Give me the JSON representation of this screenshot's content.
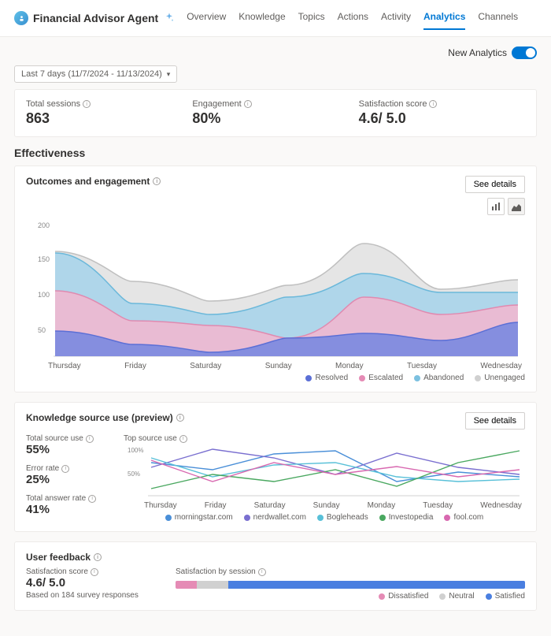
{
  "header": {
    "title": "Financial Advisor Agent",
    "tabs": [
      "Overview",
      "Knowledge",
      "Topics",
      "Actions",
      "Activity",
      "Analytics",
      "Channels"
    ],
    "active_tab": "Analytics"
  },
  "toggle_label": "New Analytics",
  "date_range": "Last 7 days (11/7/2024 - 11/13/2024)",
  "kpis": {
    "sessions": {
      "label": "Total sessions",
      "value": "863"
    },
    "engagement": {
      "label": "Engagement",
      "value": "80%"
    },
    "satisfaction": {
      "label": "Satisfaction score",
      "value": "4.6/ 5.0"
    }
  },
  "effectiveness_title": "Effectiveness",
  "outcomes": {
    "title": "Outcomes and engagement",
    "see_details": "See details",
    "y_ticks": [
      "200",
      "150",
      "100",
      "50"
    ],
    "x_labels": [
      "Thursday",
      "Friday",
      "Saturday",
      "Sunday",
      "Monday",
      "Tuesday",
      "Wednesday"
    ],
    "legend": [
      {
        "name": "Resolved",
        "color": "#5b6fd6"
      },
      {
        "name": "Escalated",
        "color": "#e58bb5"
      },
      {
        "name": "Abandoned",
        "color": "#7cc1e0"
      },
      {
        "name": "Unengaged",
        "color": "#d0d0d0"
      }
    ]
  },
  "ks": {
    "title": "Knowledge source use (preview)",
    "see_details": "See details",
    "stats": {
      "source": {
        "label": "Total source use",
        "value": "55%"
      },
      "error": {
        "label": "Error rate",
        "value": "25%"
      },
      "answer": {
        "label": "Total answer rate",
        "value": "41%"
      }
    },
    "chart_label": "Top source use",
    "y_ticks": [
      "100%",
      "50%"
    ],
    "x_labels": [
      "Thursday",
      "Friday",
      "Saturday",
      "Sunday",
      "Monday",
      "Tuesday",
      "Wednesday"
    ],
    "legend": [
      {
        "name": "morningstar.com",
        "color": "#4a8fd8"
      },
      {
        "name": "nerdwallet.com",
        "color": "#7a6fd0"
      },
      {
        "name": "Bogleheads",
        "color": "#58c0d8"
      },
      {
        "name": "Investopedia",
        "color": "#4aa860"
      },
      {
        "name": "fool.com",
        "color": "#d868b0"
      }
    ]
  },
  "feedback": {
    "title": "User feedback",
    "score_label": "Satisfaction score",
    "score_value": "4.6/ 5.0",
    "based_on": "Based on 184 survey responses",
    "bar_label": "Satisfaction by session",
    "segments": [
      {
        "name": "Dissatisfied",
        "color": "#e58bb5",
        "pct": 6
      },
      {
        "name": "Neutral",
        "color": "#d0d0d0",
        "pct": 9
      },
      {
        "name": "Satisfied",
        "color": "#4a7fe0",
        "pct": 85
      }
    ]
  },
  "chart_data": [
    {
      "type": "area",
      "title": "Outcomes and engagement",
      "xlabel": "",
      "ylabel": "",
      "ylim": [
        0,
        200
      ],
      "categories": [
        "Thursday",
        "Friday",
        "Saturday",
        "Sunday",
        "Monday",
        "Tuesday",
        "Wednesday"
      ],
      "series": [
        {
          "name": "Resolved",
          "values": [
            40,
            20,
            7,
            28,
            35,
            25,
            53
          ]
        },
        {
          "name": "Escalated",
          "values": [
            97,
            55,
            48,
            30,
            90,
            65,
            80
          ]
        },
        {
          "name": "Abandoned",
          "values": [
            150,
            80,
            65,
            90,
            122,
            98,
            98
          ]
        },
        {
          "name": "Unengaged",
          "values": [
            152,
            113,
            85,
            108,
            166,
            102,
            115
          ]
        }
      ]
    },
    {
      "type": "line",
      "title": "Top source use",
      "xlabel": "",
      "ylabel": "",
      "ylim": [
        0,
        100
      ],
      "categories": [
        "Thursday",
        "Friday",
        "Saturday",
        "Sunday",
        "Monday",
        "Tuesday",
        "Wednesday"
      ],
      "series": [
        {
          "name": "morningstar.com",
          "values": [
            70,
            55,
            88,
            95,
            30,
            50,
            40
          ]
        },
        {
          "name": "nerdwallet.com",
          "values": [
            60,
            98,
            80,
            45,
            90,
            60,
            45
          ]
        },
        {
          "name": "Bogleheads",
          "values": [
            80,
            40,
            65,
            70,
            40,
            30,
            35
          ]
        },
        {
          "name": "Investopedia",
          "values": [
            15,
            45,
            30,
            55,
            20,
            70,
            95
          ]
        },
        {
          "name": "fool.com",
          "values": [
            75,
            30,
            70,
            45,
            62,
            40,
            55
          ]
        }
      ]
    },
    {
      "type": "bar",
      "title": "Satisfaction by session",
      "categories": [
        "Dissatisfied",
        "Neutral",
        "Satisfied"
      ],
      "values": [
        6,
        9,
        85
      ],
      "xlabel": "",
      "ylabel": "percent"
    }
  ]
}
